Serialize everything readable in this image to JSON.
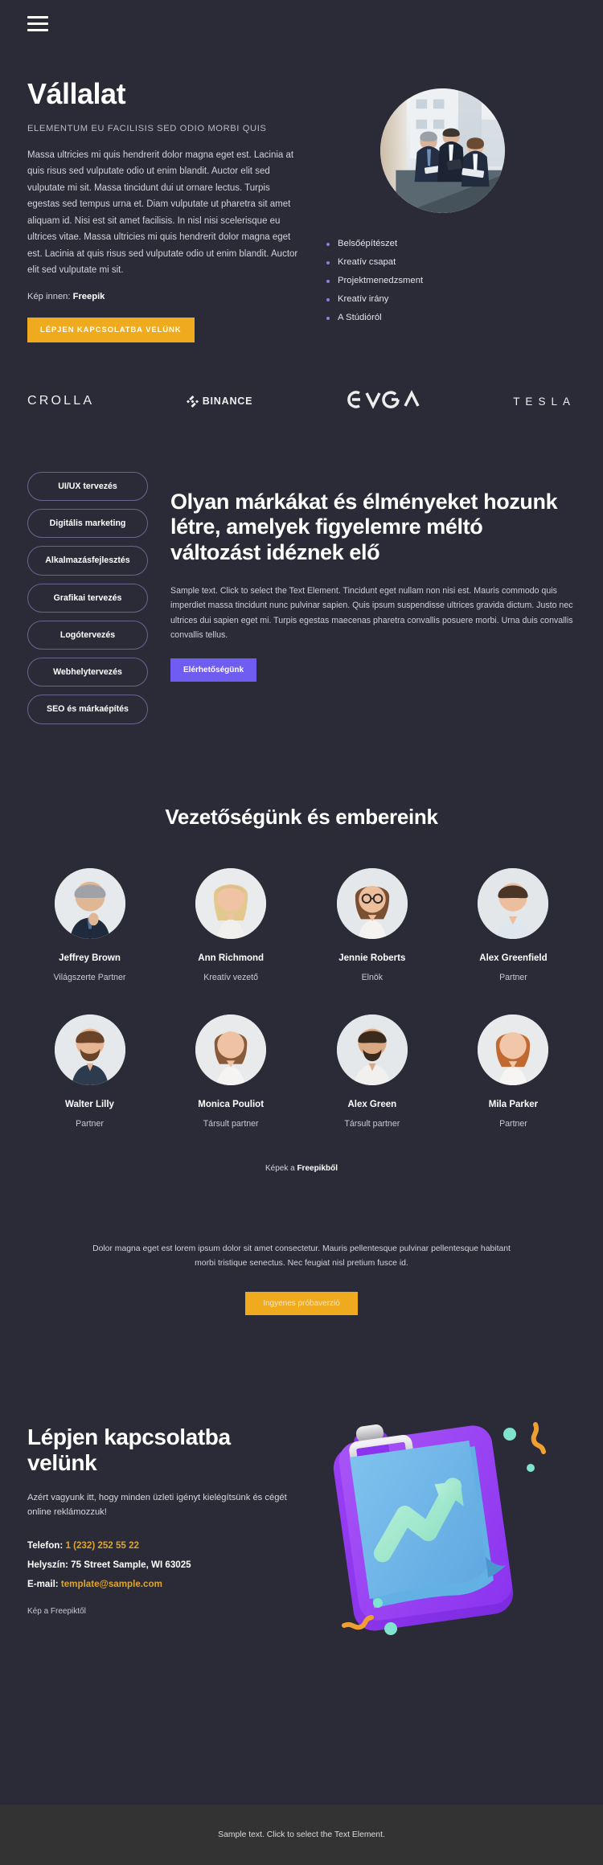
{
  "header": {
    "menu_icon": "hamburger-menu-icon"
  },
  "hero": {
    "title": "Vállalat",
    "subtitle": "ELEMENTUM EU FACILISIS SED ODIO MORBI QUIS",
    "body": "Massa ultricies mi quis hendrerit dolor magna eget est. Lacinia at quis risus sed vulputate odio ut enim blandit. Auctor elit sed vulputate mi sit. Massa tincidunt dui ut ornare lectus. Turpis egestas sed tempus urna et. Diam vulputate ut pharetra sit amet aliquam id. Nisi est sit amet facilisis. In nisl nisi scelerisque eu ultrices vitae. Massa ultricies mi quis hendrerit dolor magna eget est. Lacinia at quis risus sed vulputate odio ut enim blandit. Auctor elit sed vulputate mi sit.",
    "credit_label": "Kép innen: ",
    "credit_source": "Freepik",
    "cta_label": "LÉPJEN KAPCSOLATBA VELÜNK",
    "photo_alt": "business-team-photo",
    "list": [
      "Belsőépítészet",
      "Kreatív csapat",
      "Projektmenedzsment",
      "Kreatív irány",
      "A Stúdióról"
    ]
  },
  "logos": [
    {
      "name": "CROLLA",
      "kind": "crolla"
    },
    {
      "name": "BINANCE",
      "kind": "binance"
    },
    {
      "name": "EVGA",
      "kind": "evga"
    },
    {
      "name": "TESLA",
      "kind": "tesla"
    }
  ],
  "services": {
    "pills": [
      "UI/UX tervezés",
      "Digitális marketing",
      "Alkalmazásfejlesztés",
      "Grafikai tervezés",
      "Logótervezés",
      "Webhelytervezés",
      "SEO és márkaépítés"
    ],
    "title": "Olyan márkákat és élményeket hozunk létre, amelyek figyelemre méltó változást idéznek elő",
    "body": "Sample text. Click to select the Text Element. Tincidunt eget nullam non nisi est. Mauris commodo quis imperdiet massa tincidunt nunc pulvinar sapien. Quis ipsum suspendisse ultrices gravida dictum. Justo nec ultrices dui sapien eget mi. Turpis egestas maecenas pharetra convallis posuere morbi. Urna duis convallis convallis tellus.",
    "cta_label": "Elérhetőségünk"
  },
  "team": {
    "title": "Vezetőségünk és embereink",
    "credit_label": "Képek a ",
    "credit_source": "Freepikből",
    "members": [
      {
        "name": "Jeffrey Brown",
        "role": "Világszerte Partner",
        "avatar": "avatar-jeffrey-brown"
      },
      {
        "name": "Ann Richmond",
        "role": "Kreatív vezető",
        "avatar": "avatar-ann-richmond"
      },
      {
        "name": "Jennie Roberts",
        "role": "Elnök",
        "avatar": "avatar-jennie-roberts"
      },
      {
        "name": "Alex Greenfield",
        "role": "Partner",
        "avatar": "avatar-alex-greenfield"
      },
      {
        "name": "Walter Lilly",
        "role": "Partner",
        "avatar": "avatar-walter-lilly"
      },
      {
        "name": "Monica Pouliot",
        "role": "Társult partner",
        "avatar": "avatar-monica-pouliot"
      },
      {
        "name": "Alex Green",
        "role": "Társult partner",
        "avatar": "avatar-alex-green"
      },
      {
        "name": "Mila Parker",
        "role": "Partner",
        "avatar": "avatar-mila-parker"
      }
    ]
  },
  "trial": {
    "body": "Dolor magna eget est lorem ipsum dolor sit amet consectetur. Mauris pellentesque pulvinar pellentesque habitant morbi tristique senectus. Nec feugiat nisl pretium fusce id.",
    "cta_label": "Ingyenes próbaverzió"
  },
  "contact": {
    "title": "Lépjen kapcsolatba velünk",
    "lead": "Azért vagyunk itt, hogy minden üzleti igényt kielégítsünk és cégét online reklámozzuk!",
    "phone_label": "Telefon: ",
    "phone_value": "1 (232) 252 55 22",
    "location_label": "Helyszín: ",
    "location_value": "75 Street Sample, WI 63025",
    "email_label": "E-mail: ",
    "email_value": "template@sample.com",
    "credit": "Kép a Freepiktől",
    "art_alt": "clipboard-growth-chart-illustration"
  },
  "footer": {
    "text": "Sample text. Click to select the Text Element."
  },
  "colors": {
    "background": "#2b2b38",
    "footer_background": "#333333",
    "accent_yellow": "#efaa1e",
    "accent_purple": "#6f5cf0",
    "pill_border": "#6b6390",
    "bullet": "#8c7fe0",
    "contact_value": "#e0a528",
    "text_primary": "#ffffff",
    "text_secondary": "#d3d3db"
  }
}
